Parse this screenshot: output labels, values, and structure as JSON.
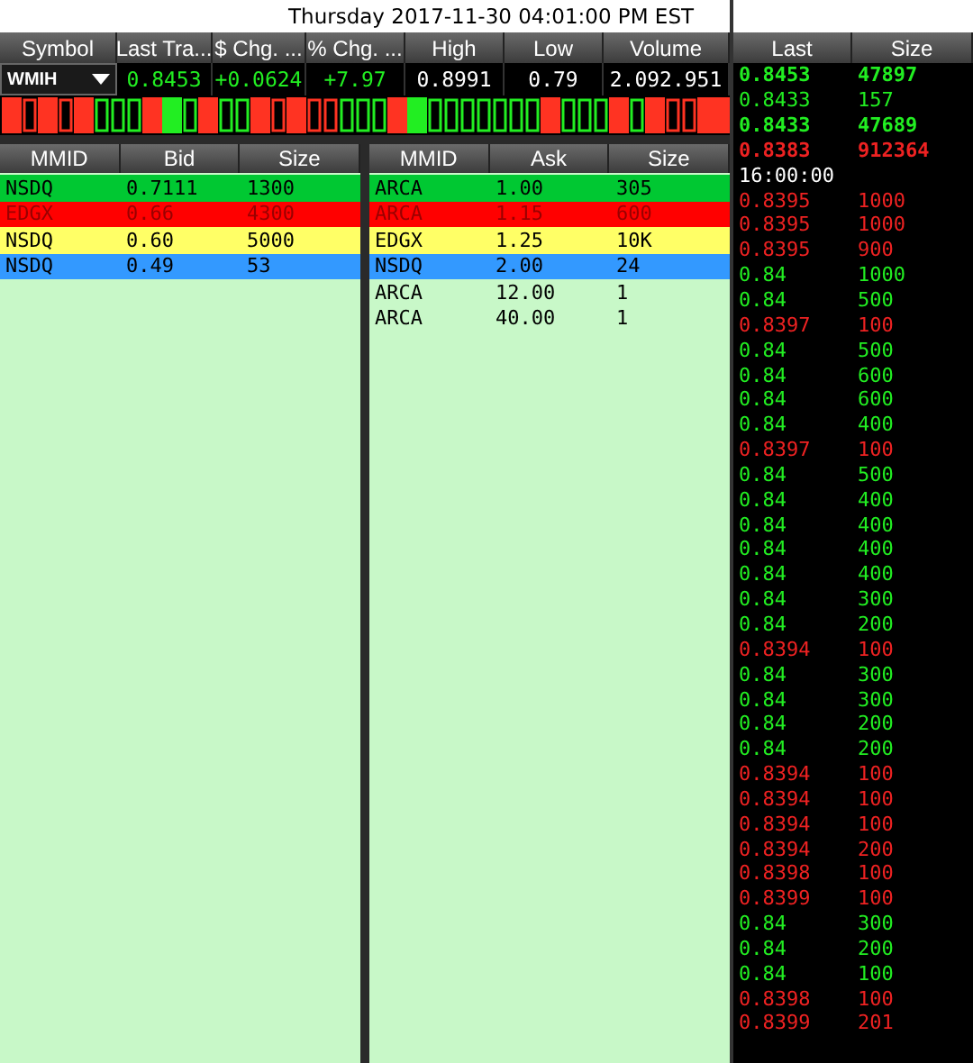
{
  "datetime": "Thursday 2017-11-30 04:01:00 PM EST",
  "quote": {
    "columns": [
      "Symbol",
      "Last Tra...",
      "$ Chg. ...",
      "% Chg. ...",
      "High",
      "Low",
      "Volume"
    ],
    "symbol": "WMIH",
    "cells": [
      {
        "text": "0.8453",
        "kind": "up"
      },
      {
        "text": "+0.0624",
        "kind": "up"
      },
      {
        "text": "+7.97",
        "kind": "up"
      },
      {
        "text": "0.8991",
        "kind": "flat"
      },
      {
        "text": "0.79",
        "kind": "flat"
      },
      {
        "text": "2.092.951",
        "kind": "flat"
      }
    ]
  },
  "bid_book": {
    "columns": [
      "MMID",
      "Bid",
      "Size"
    ],
    "rows": [
      {
        "mmid": "NSDQ",
        "price": "0.7111",
        "size": "1300",
        "color": "#00c832"
      },
      {
        "mmid": "EDGX",
        "price": "0.66",
        "size": "4300",
        "color": "#ff0000"
      },
      {
        "mmid": "NSDQ",
        "price": "0.60",
        "size": "5000",
        "color": "#ffff66"
      },
      {
        "mmid": "NSDQ",
        "price": "0.49",
        "size": "53",
        "color": "#3399ff"
      }
    ]
  },
  "ask_book": {
    "columns": [
      "MMID",
      "Ask",
      "Size"
    ],
    "rows": [
      {
        "mmid": "ARCA",
        "price": "1.00",
        "size": "305",
        "color": "#00c832"
      },
      {
        "mmid": "ARCA",
        "price": "1.15",
        "size": "600",
        "color": "#ff0000"
      },
      {
        "mmid": "EDGX",
        "price": "1.25",
        "size": "10K",
        "color": "#ffff66"
      },
      {
        "mmid": "NSDQ",
        "price": "2.00",
        "size": "24",
        "color": "#3399ff"
      },
      {
        "mmid": "ARCA",
        "price": "12.00",
        "size": "1"
      },
      {
        "mmid": "ARCA",
        "price": "40.00",
        "size": "1"
      }
    ]
  },
  "time_and_sales": {
    "columns": [
      "Last",
      "Size"
    ],
    "rows": [
      {
        "last": "0.8453",
        "size": "47897",
        "kind": "up",
        "bold": true
      },
      {
        "last": "0.8433",
        "size": "157",
        "kind": "up",
        "bold": false
      },
      {
        "last": "0.8433",
        "size": "47689",
        "kind": "up",
        "bold": true
      },
      {
        "last": "0.8383",
        "size": "912364",
        "kind": "down",
        "bold": true
      },
      {
        "last": "16:00:00",
        "kind": "time",
        "bold": false
      },
      {
        "last": "0.8395",
        "size": "1000",
        "kind": "down",
        "bold": false
      },
      {
        "last": "0.8395",
        "size": "1000",
        "kind": "down",
        "bold": false
      },
      {
        "last": "0.8395",
        "size": "900",
        "kind": "down",
        "bold": false
      },
      {
        "last": "0.84",
        "size": "1000",
        "kind": "up",
        "bold": false
      },
      {
        "last": "0.84",
        "size": "500",
        "kind": "up",
        "bold": false
      },
      {
        "last": "0.8397",
        "size": "100",
        "kind": "down",
        "bold": false
      },
      {
        "last": "0.84",
        "size": "500",
        "kind": "up",
        "bold": false
      },
      {
        "last": "0.84",
        "size": "600",
        "kind": "up",
        "bold": false
      },
      {
        "last": "0.84",
        "size": "600",
        "kind": "up",
        "bold": false
      },
      {
        "last": "0.84",
        "size": "400",
        "kind": "up",
        "bold": false
      },
      {
        "last": "0.8397",
        "size": "100",
        "kind": "down",
        "bold": false
      },
      {
        "last": "0.84",
        "size": "500",
        "kind": "up",
        "bold": false
      },
      {
        "last": "0.84",
        "size": "400",
        "kind": "up",
        "bold": false
      },
      {
        "last": "0.84",
        "size": "400",
        "kind": "up",
        "bold": false
      },
      {
        "last": "0.84",
        "size": "400",
        "kind": "up",
        "bold": false
      },
      {
        "last": "0.84",
        "size": "400",
        "kind": "up",
        "bold": false
      },
      {
        "last": "0.84",
        "size": "300",
        "kind": "up",
        "bold": false
      },
      {
        "last": "0.84",
        "size": "200",
        "kind": "up",
        "bold": false
      },
      {
        "last": "0.8394",
        "size": "100",
        "kind": "down",
        "bold": false
      },
      {
        "last": "0.84",
        "size": "300",
        "kind": "up",
        "bold": false
      },
      {
        "last": "0.84",
        "size": "300",
        "kind": "up",
        "bold": false
      },
      {
        "last": "0.84",
        "size": "200",
        "kind": "up",
        "bold": false
      },
      {
        "last": "0.84",
        "size": "200",
        "kind": "up",
        "bold": false
      },
      {
        "last": "0.8394",
        "size": "100",
        "kind": "down",
        "bold": false
      },
      {
        "last": "0.8394",
        "size": "100",
        "kind": "down",
        "bold": false
      },
      {
        "last": "0.8394",
        "size": "100",
        "kind": "down",
        "bold": false
      },
      {
        "last": "0.8394",
        "size": "200",
        "kind": "down",
        "bold": false
      },
      {
        "last": "0.8398",
        "size": "100",
        "kind": "down",
        "bold": false
      },
      {
        "last": "0.8399",
        "size": "100",
        "kind": "down",
        "bold": false
      },
      {
        "last": "0.84",
        "size": "300",
        "kind": "up",
        "bold": false
      },
      {
        "last": "0.84",
        "size": "200",
        "kind": "up",
        "bold": false
      },
      {
        "last": "0.84",
        "size": "100",
        "kind": "up",
        "bold": false
      },
      {
        "last": "0.8398",
        "size": "100",
        "kind": "down",
        "bold": false
      },
      {
        "last": "0.8399",
        "size": "201",
        "kind": "down",
        "bold": false
      }
    ]
  }
}
